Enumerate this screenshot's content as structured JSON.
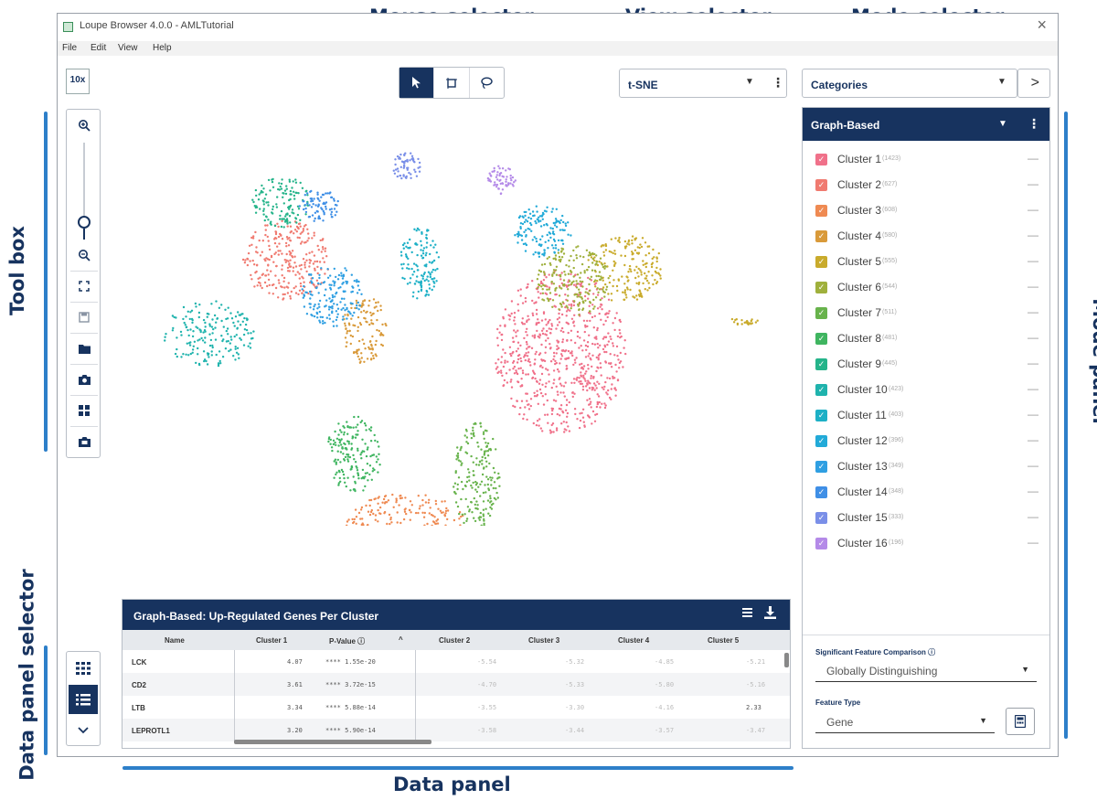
{
  "annotations": {
    "mouse_selector": "Mouse selector",
    "view_selector": "View selector",
    "mode_selector": "Mode selector",
    "tool_box": "Tool box",
    "mode_panel": "Mode panel",
    "data_panel_selector": "Data panel selector",
    "data_panel": "Data panel",
    "annotation_color": "#17335f",
    "bar_color": "#2d7fc9"
  },
  "window": {
    "title": "Loupe Browser 4.0.0 - AMLTutorial",
    "close": "×",
    "menu": [
      "File",
      "Edit",
      "View",
      "Help"
    ]
  },
  "logo": "10x",
  "toolbox": {
    "icons": [
      "zoom-in-icon",
      "zoom-slider",
      "zoom-out-icon",
      "fit-screen-icon",
      "save-icon",
      "folder-icon",
      "camera-icon",
      "grid-icon",
      "export-image-icon"
    ]
  },
  "mouse_selector": {
    "active": "pointer",
    "tools": [
      "pointer-icon",
      "box-select-icon",
      "lasso-icon"
    ]
  },
  "view_selector": {
    "value": "t-SNE",
    "kebab": "⋮"
  },
  "mode_selector": {
    "value": "Categories",
    "next": ">"
  },
  "mode_panel": {
    "header": "Graph-Based",
    "clusters": [
      {
        "name": "Cluster 1",
        "count": "(1423)",
        "color": "#f0718a"
      },
      {
        "name": "Cluster 2",
        "count": "(627)",
        "color": "#f07a70"
      },
      {
        "name": "Cluster 3",
        "count": "(608)",
        "color": "#ef8a52"
      },
      {
        "name": "Cluster 4",
        "count": "(580)",
        "color": "#d99a3a"
      },
      {
        "name": "Cluster 5",
        "count": "(555)",
        "color": "#c9ab2c"
      },
      {
        "name": "Cluster 6",
        "count": "(544)",
        "color": "#9fb03c"
      },
      {
        "name": "Cluster 7",
        "count": "(511)",
        "color": "#68b34c"
      },
      {
        "name": "Cluster 8",
        "count": "(481)",
        "color": "#3fb560"
      },
      {
        "name": "Cluster 9",
        "count": "(445)",
        "color": "#25b48a"
      },
      {
        "name": "Cluster 10",
        "count": "(423)",
        "color": "#1fb3ad"
      },
      {
        "name": "Cluster 11",
        "count": "(403)",
        "color": "#1db0c6"
      },
      {
        "name": "Cluster 12",
        "count": "(396)",
        "color": "#22aad8"
      },
      {
        "name": "Cluster 13",
        "count": "(349)",
        "color": "#2f9fe2"
      },
      {
        "name": "Cluster 14",
        "count": "(348)",
        "color": "#3f8fe6"
      },
      {
        "name": "Cluster 15",
        "count": "(333)",
        "color": "#7a8fe8"
      },
      {
        "name": "Cluster 16",
        "count": "(196)",
        "color": "#b48ae8"
      }
    ],
    "sig_label": "Significant Feature Comparison ⓘ",
    "sig_value": "Globally Distinguishing",
    "ft_label": "Feature Type",
    "ft_value": "Gene"
  },
  "data_panel": {
    "title": "Graph-Based: Up-Regulated Genes Per Cluster",
    "columns": [
      "Name",
      "Cluster 1",
      "P-Value ⓘ",
      "Cluster 2",
      "Cluster 3",
      "Cluster 4",
      "Cluster 5"
    ],
    "rows": [
      {
        "name": "LCK",
        "c1": "4.07",
        "p": "**** 1.55e-20",
        "c2": "-5.54",
        "c3": "-5.32",
        "c4": "-4.85",
        "c5": "-5.21"
      },
      {
        "name": "CD2",
        "c1": "3.61",
        "p": "**** 3.72e-15",
        "c2": "-4.70",
        "c3": "-5.33",
        "c4": "-5.80",
        "c5": "-5.16"
      },
      {
        "name": "LTB",
        "c1": "3.34",
        "p": "**** 5.88e-14",
        "c2": "-3.55",
        "c3": "-3.30",
        "c4": "-4.16",
        "c5": "2.33"
      },
      {
        "name": "LEPROTL1",
        "c1": "3.20",
        "p": "**** 5.90e-14",
        "c2": "-3.58",
        "c3": "-3.44",
        "c4": "-3.57",
        "c5": "-3.47"
      }
    ]
  },
  "data_panel_selector": {
    "buttons": [
      "grid-view-icon",
      "list-view-icon",
      "collapse-chevron-icon"
    ],
    "active": "list"
  }
}
